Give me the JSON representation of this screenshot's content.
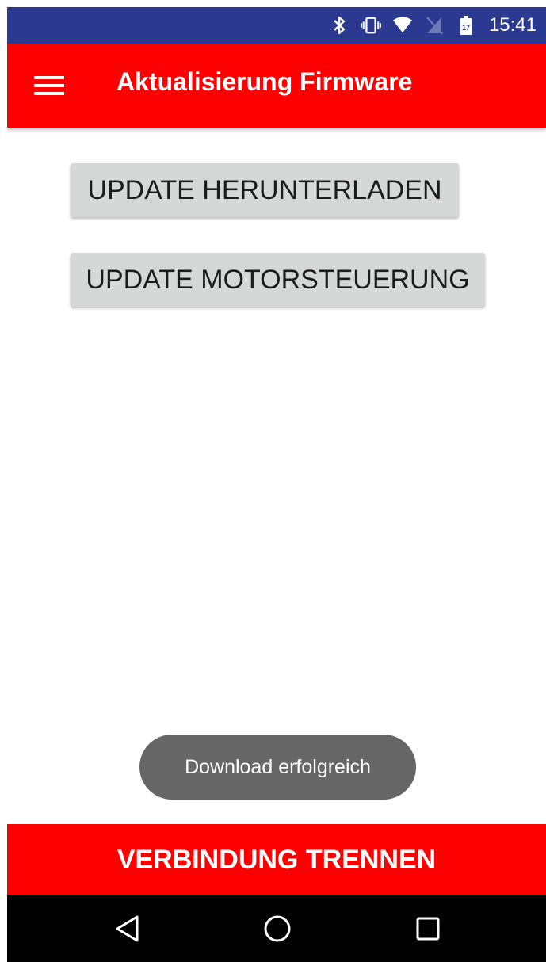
{
  "status_bar": {
    "time": "15:41",
    "icons": [
      "bluetooth-icon",
      "vibrate-icon",
      "wifi-icon",
      "no-sim-icon",
      "battery-icon"
    ],
    "battery_label": "17",
    "background_color": "#2b3990"
  },
  "app_bar": {
    "title": "Aktualisierung Firmware",
    "menu_icon": "hamburger-menu-icon",
    "background_color": "#ff0000"
  },
  "main": {
    "download_button_label": "UPDATE HERUNTERLADEN",
    "motor_button_label": "UPDATE MOTORSTEUERUNG"
  },
  "toast": {
    "message": "Download erfolgreich"
  },
  "footer": {
    "disconnect_label": "VERBINDUNG TRENNEN",
    "background_color": "#ff0000"
  },
  "nav_bar": {
    "icons": [
      "back-icon",
      "home-icon",
      "recents-icon"
    ]
  }
}
